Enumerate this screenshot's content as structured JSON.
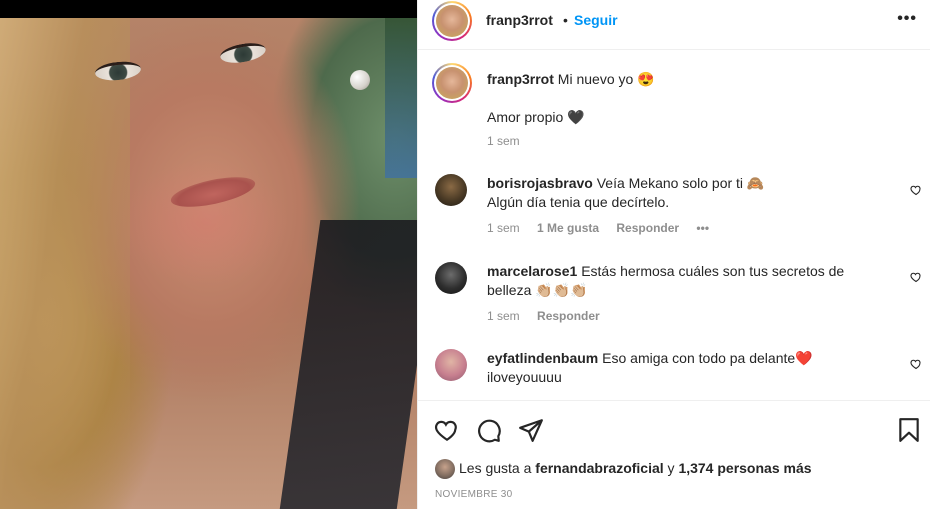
{
  "post": {
    "username": "franp3rrot",
    "follow_label": "Seguir",
    "separator": "•",
    "more_icon": "more-horizontal-icon"
  },
  "caption": {
    "username": "franp3rrot",
    "text": "Mi nuevo yo 😍",
    "extra": "Amor propio 🖤",
    "time": "1 sem"
  },
  "comments": [
    {
      "username": "borisrojasbravo",
      "text": "Veía Mekano solo por ti 🙈",
      "text2": "Algún día tenia que decírtelo.",
      "time": "1 sem",
      "likes": "1 Me gusta",
      "reply": "Responder",
      "more": "•••"
    },
    {
      "username": "marcelarose1",
      "text": "Estás hermosa cuáles son tus secretos de",
      "text2": "belleza 👏🏼👏🏼👏🏼",
      "time": "1 sem",
      "reply": "Responder"
    },
    {
      "username": "eyfatlindenbaum",
      "text": "Eso amiga con todo pa delante❤️",
      "text2": "iloveyouuuu"
    }
  ],
  "likes": {
    "prefix": "Les gusta a",
    "user": "fernandabrazoficial",
    "connector": "y",
    "count": "1,374 personas más"
  },
  "date": "NOVIEMBRE 30"
}
